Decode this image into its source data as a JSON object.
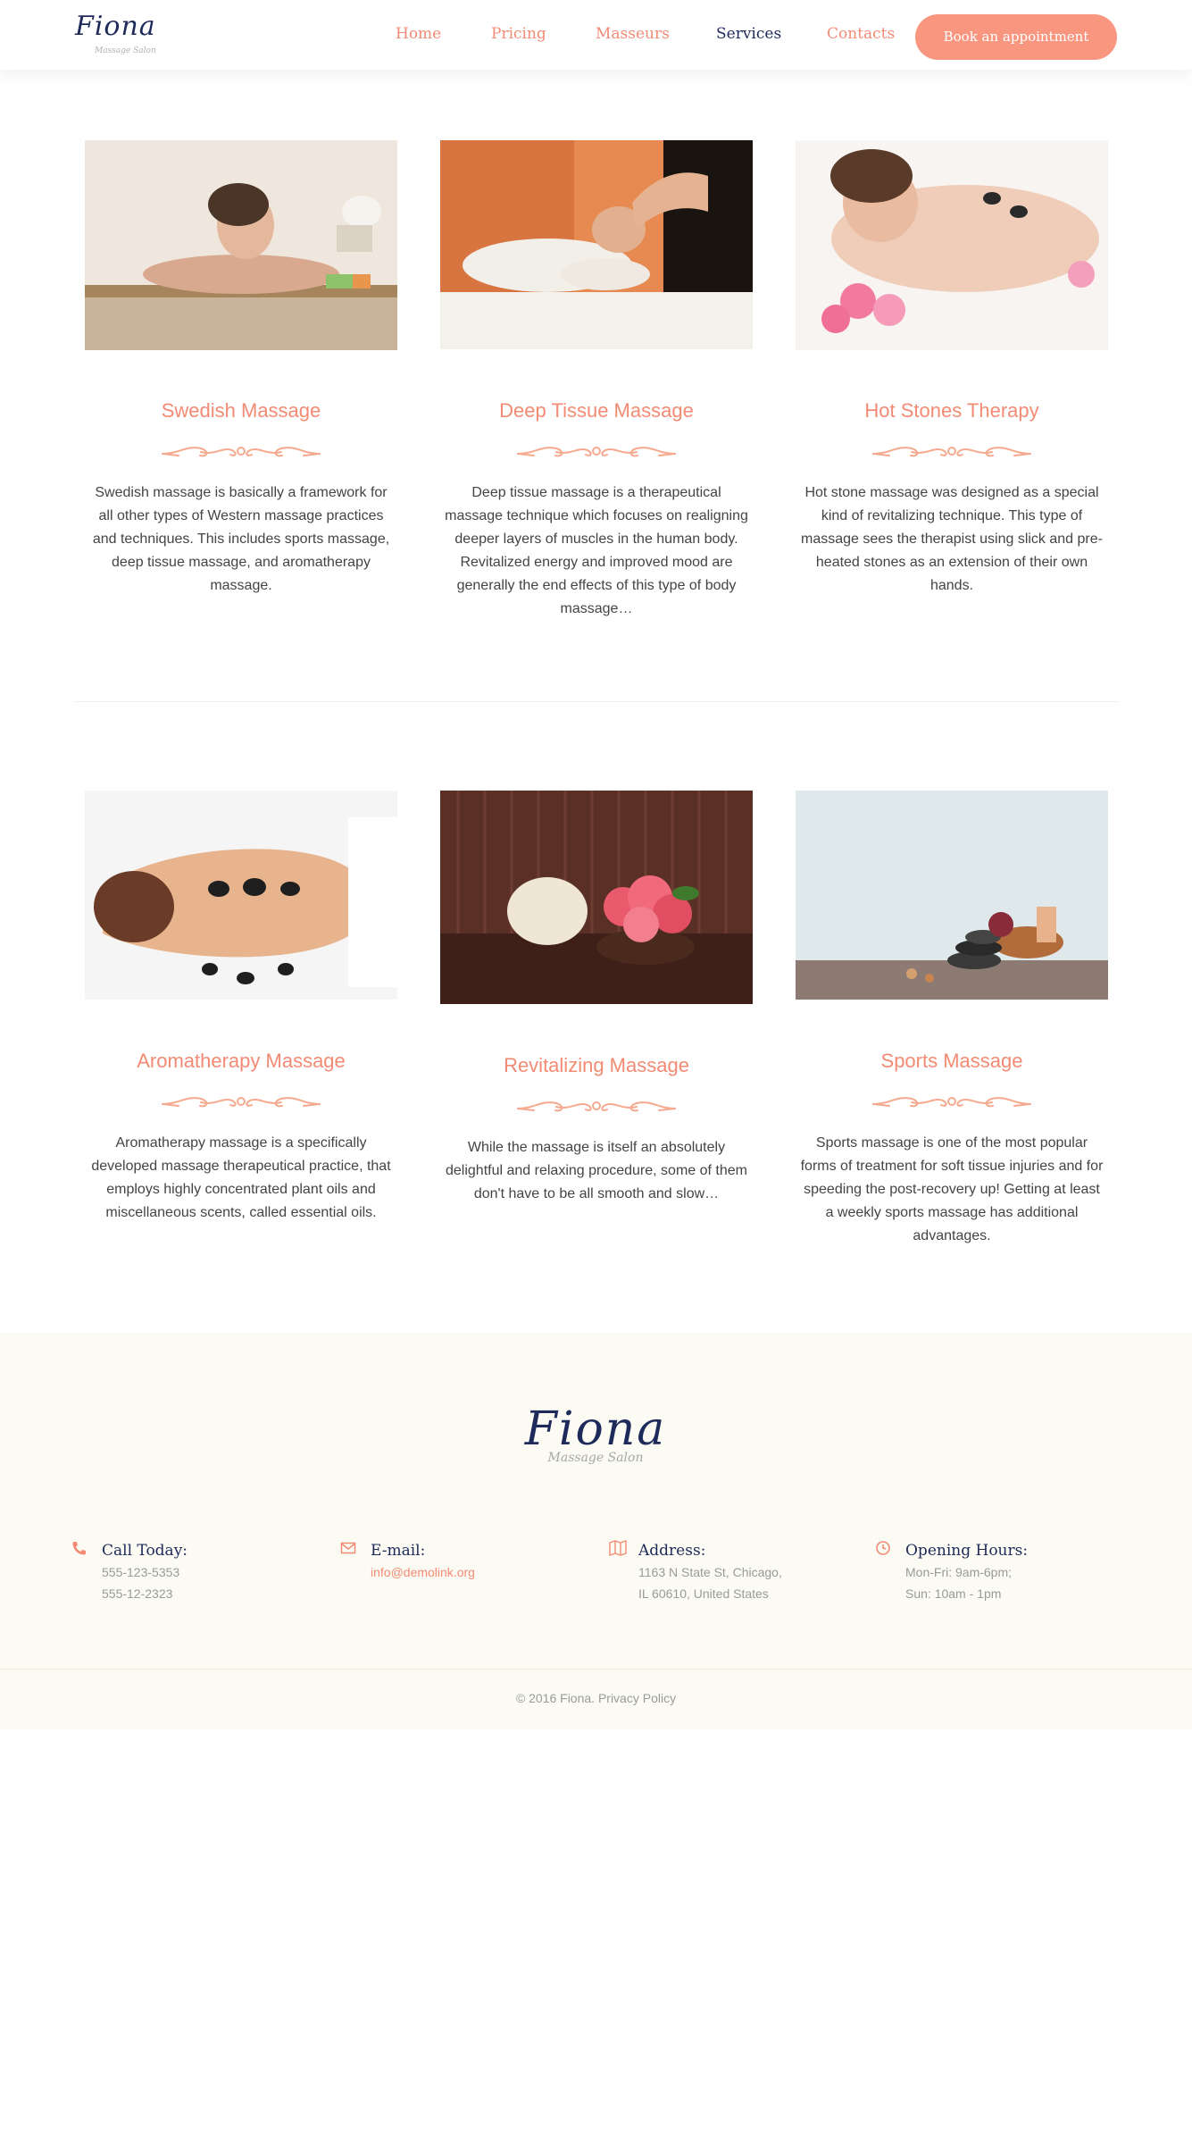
{
  "header": {
    "logo_text": "Fiona",
    "logo_sub": "Massage Salon",
    "nav": [
      {
        "label": "Home"
      },
      {
        "label": "Pricing"
      },
      {
        "label": "Masseurs"
      },
      {
        "label": "Services"
      },
      {
        "label": "Contacts"
      }
    ],
    "book_label": "Book an appointment"
  },
  "services": [
    {
      "title": "Swedish Massage",
      "text": "Swedish massage is basically a framework for all other types of Western massage practices and techniques. This includes sports massage, deep tissue massage, and aromatherapy massage."
    },
    {
      "title": "Deep Tissue Massage",
      "text": "Deep tissue massage is a therapeutical massage technique which focuses on realigning deeper layers of muscles in the human body. Revitalized energy and improved mood are generally the end effects of this type of body massage…"
    },
    {
      "title": "Hot Stones Therapy",
      "text": "Hot stone massage was designed as a special kind of revitalizing technique. This type of massage sees the therapist using slick and pre-heated stones as an extension of their own hands."
    },
    {
      "title": "Aromatherapy Massage",
      "text": "Aromatherapy massage is a specifically developed massage therapeutical practice, that employs highly concentrated plant oils and miscellaneous scents, called essential oils."
    },
    {
      "title": "Revitalizing Massage",
      "text": "While the massage is itself an absolutely delightful and relaxing procedure, some of them don't have to be all smooth and slow…"
    },
    {
      "title": "Sports Massage",
      "text": "Sports massage is one of the most popular forms of treatment for soft tissue injuries and for speeding the post-recovery up! Getting at least a weekly sports massage has additional advantages."
    }
  ],
  "footer": {
    "logo_text": "Fiona",
    "logo_sub": "Massage Salon",
    "call": {
      "title": "Call Today:",
      "line1": "555-123-5353",
      "line2": "555-12-2323",
      "icon": "phone-icon"
    },
    "email": {
      "title": "E-mail:",
      "line1": "info@demolink.org",
      "icon": "envelope-icon"
    },
    "address": {
      "title": "Address:",
      "line1": "1163 N State St, Chicago,",
      "line2": "IL 60610, United States",
      "icon": "map-icon"
    },
    "hours": {
      "title": "Opening Hours:",
      "line1": "Mon-Fri: 9am-6pm;",
      "line2": "Sun: 10am - 1pm",
      "icon": "clock-icon"
    },
    "copyright": "© 2016 Fiona. Privacy Policy"
  },
  "colors": {
    "accent": "#f38b74",
    "button": "#f99680",
    "navy": "#1e2a5a",
    "footer_bg": "#fbfaf3"
  }
}
